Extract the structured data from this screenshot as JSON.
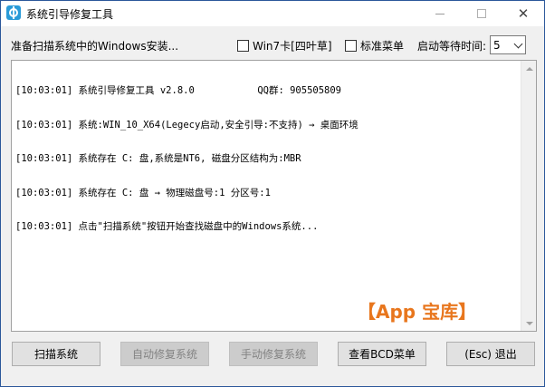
{
  "window": {
    "title": "系统引导修复工具",
    "controls": {
      "minimize": "—",
      "maximize": "□",
      "close": "✕"
    }
  },
  "toolbar": {
    "status": "准备扫描系统中的Windows安装...",
    "win7_checkbox": "Win7卡[四叶草]",
    "standard_menu_checkbox": "标准菜单",
    "wait_time_label": "启动等待时间:",
    "wait_time_value": "5"
  },
  "log": {
    "lines": [
      "[10:03:01] 系统引导修复工具 v2.8.0           QQ群: 905505809",
      "[10:03:01] 系统:WIN_10_X64(Legecy启动,安全引导:不支持) → 桌面环境",
      "[10:03:01] 系统存在 C: 盘,系统是NT6, 磁盘分区结构为:MBR",
      "[10:03:01] 系统存在 C: 盘 → 物理磁盘号:1 分区号:1",
      "[10:03:01] 点击\"扫描系统\"按钮开始查找磁盘中的Windows系统..."
    ]
  },
  "watermark": "【App 宝库】",
  "buttons": {
    "scan": "扫描系统",
    "auto_repair": "自动修复系统",
    "manual_repair": "手动修复系统",
    "view_bcd": "查看BCD菜单",
    "exit": "(Esc) 退出"
  },
  "colors": {
    "accent": "#2a9bd8",
    "watermark": "#e8761d",
    "disabled_text": "#838383"
  }
}
